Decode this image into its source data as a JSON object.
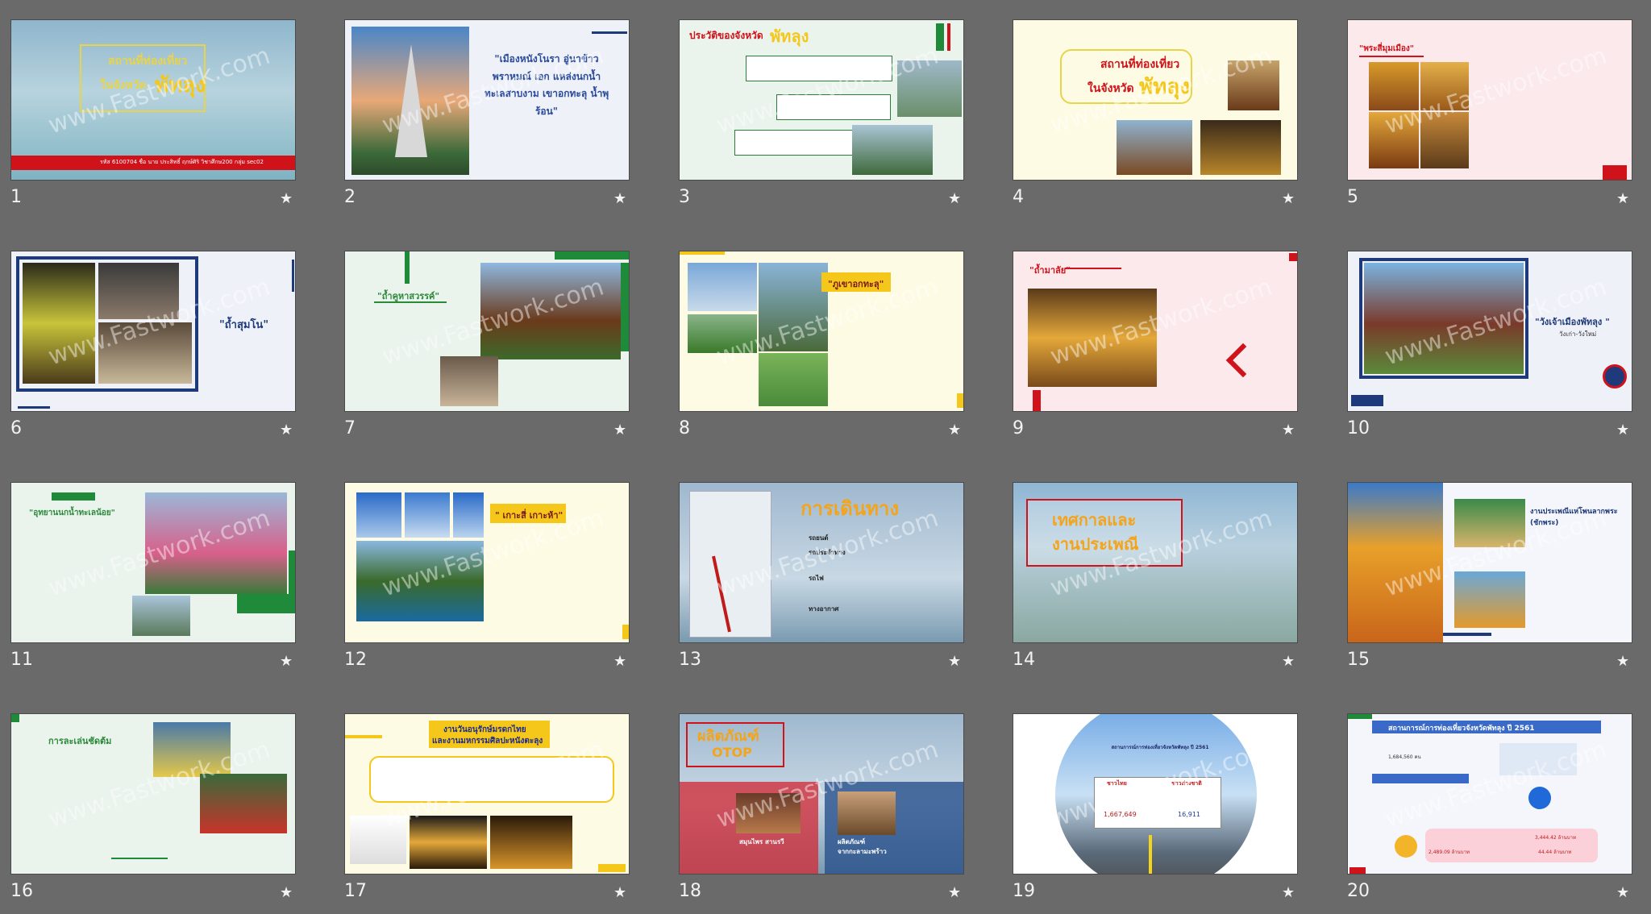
{
  "slides": [
    {
      "n": "1",
      "title_line1": "สถานที่ท่องเที่ยว",
      "title_line2": "ในจังหวัด",
      "title_accent": "พัทลุง",
      "footer": "รหัส 6100704 ชื่อ นาย ประสิทธิ์ ฤกษ์ศิริ วิชาศึกษ200 กลุ่ม sec02"
    },
    {
      "n": "2",
      "quote": "\"เมืองหนังโนรา อู่นาข้าว พราหมณ์ เอก แหล่งนกน้ำ ทะเลสาบงาม เขาอกทะลุ น้ำพุร้อน\""
    },
    {
      "n": "3",
      "title": "ประวัติของจังหวัด",
      "title_accent": "พัทลุง"
    },
    {
      "n": "4",
      "title_line1": "สถานที่ท่องเที่ยว",
      "title_line2": "ในจังหวัด",
      "title_accent": "พัทลุง"
    },
    {
      "n": "5",
      "title": "\"พระสี่มุมเมือง\""
    },
    {
      "n": "6",
      "title": "\"ถ้ำสุมโน\""
    },
    {
      "n": "7",
      "title": "\"ถ้ำคูหาสวรรค์\""
    },
    {
      "n": "8",
      "title": "\"ภูเขาอกทะลุ\""
    },
    {
      "n": "9",
      "title": "\"ถ้ำมาลัย\""
    },
    {
      "n": "10",
      "title": "\"วังเจ้าเมืองพัทลุง \"",
      "subtitle": "วังเก่า-วังใหม่"
    },
    {
      "n": "11",
      "title": "\"อุทยานนกน้ำทะเลน้อย\""
    },
    {
      "n": "12",
      "title": "\" เกาะสี่ เกาะห้า\""
    },
    {
      "n": "13",
      "title": "การเดินทาง",
      "bullets": [
        "รถยนต์",
        "รถประจำทาง",
        "รถไฟ",
        "ทางอากาศ"
      ]
    },
    {
      "n": "14",
      "title_line1": "เทศกาลและ",
      "title_line2": "งานประเพณี"
    },
    {
      "n": "15",
      "title": "งานประเพณีแห่โพนลากพระ (ชักพระ)"
    },
    {
      "n": "16",
      "title": "การละเล่นชัดต้ม"
    },
    {
      "n": "17",
      "title_line1": "งานวันอนุรักษ์มรดกไทย",
      "title_line2": "และงานมหกรรมศิลปะหนังตะลุง"
    },
    {
      "n": "18",
      "title_line1": "ผลิตภัณฑ์",
      "title_line2": "OTOP",
      "card1": "สมุนไพร สานรวี",
      "card2_line1": "ผลิตภัณฑ์",
      "card2_line2": "จากกะลามะพร้าว"
    },
    {
      "n": "19",
      "title": "สถานการณ์การท่องเที่ยวจังหวัดพัทลุง ปี 2561",
      "col1": "ชาวไทย",
      "col2": "ชาวต่างชาติ",
      "val1": "1,667,649",
      "val2": "16,911"
    },
    {
      "n": "20",
      "title": "สถานการณ์การท่องเที่ยวจังหวัดพัทลุง ปี 2561",
      "v1": "1,684,560 คน",
      "v2": "3,444.42 ล้านบาท",
      "v3": "2,489.09 ล้านบาท",
      "v4": "44.44 ล้านบาท"
    }
  ],
  "watermark": "www.Fastwork.com",
  "star_icon": "★"
}
